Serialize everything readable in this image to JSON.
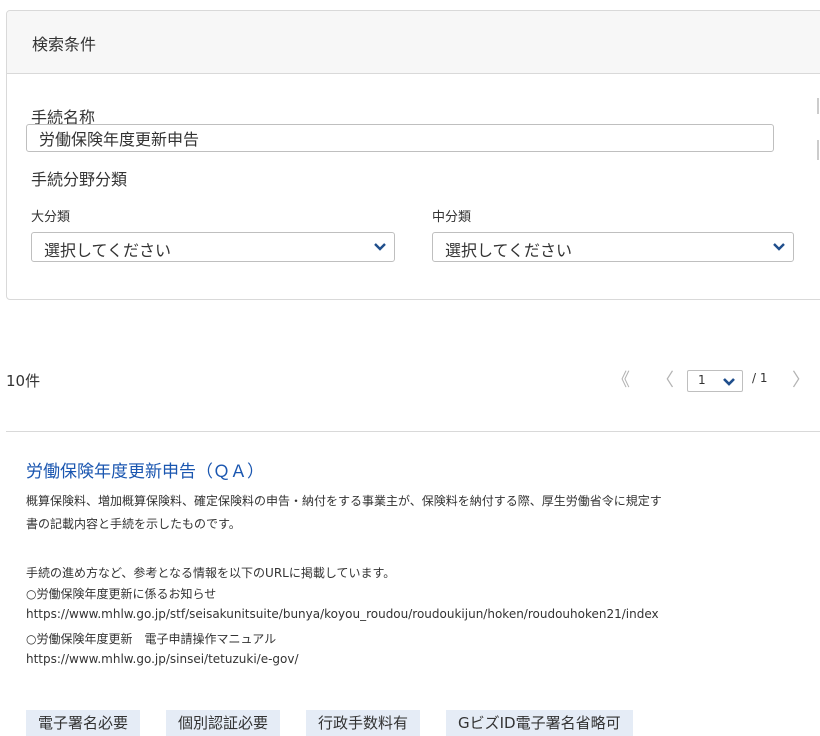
{
  "search": {
    "header_title": "検索条件",
    "procedure_name_label": "手続名称",
    "procedure_name_value": "労働保険年度更新申告",
    "category_label": "手続分野分類",
    "major_label": "大分類",
    "major_value": "選択してください",
    "middle_label": "中分類",
    "middle_value": "選択してください"
  },
  "results": {
    "count": "10件",
    "pager": {
      "first": "《",
      "prev": "〈",
      "current_page": "1",
      "total": "/ 1",
      "next": "〉"
    }
  },
  "item": {
    "title": "労働保険年度更新申告（ＱＡ）",
    "lines": [
      "概算保険料、増加概算保険料、確定保険料の申告・納付をする事業主が、保険料を納付する際、厚生労働省令に規定す",
      "書の記載内容と手続を示したものです。",
      "手続の進め方など、参考となる情報を以下のURLに掲載しています。",
      "○労働保険年度更新に係るお知らせ",
      "https://www.mhlw.go.jp/stf/seisakunitsuite/bunya/koyou_roudou/roudoukijun/hoken/roudouhoken21/index",
      "○労働保険年度更新　電子申請操作マニュアル",
      "https://www.mhlw.go.jp/sinsei/tetuzuki/e-gov/"
    ],
    "tags": [
      "電子署名必要",
      "個別認証必要",
      "行政手数料有",
      "GビズID電子署名省略可"
    ]
  },
  "colors": {
    "link": "#1a56b0",
    "tag_bg": "#e5ecf6",
    "select_arrow": "#1f4e8c"
  }
}
